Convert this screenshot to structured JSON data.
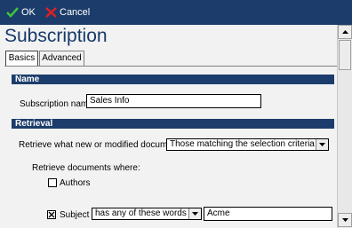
{
  "toolbar": {
    "ok_label": "OK",
    "cancel_label": "Cancel"
  },
  "form": {
    "title": "Subscription"
  },
  "tabs": [
    {
      "label": "Basics",
      "active": true
    },
    {
      "label": "Advanced",
      "active": false
    }
  ],
  "name_section": {
    "heading": "Name",
    "subscription_name_label": "Subscription name:",
    "subscription_name_value": "Sales Info"
  },
  "retrieval_section": {
    "heading": "Retrieval",
    "retrieve_label": "Retrieve what new or modified documents:",
    "retrieve_value": "Those matching the selection criteria",
    "where_label": "Retrieve documents where:",
    "authors": {
      "label": "Authors",
      "checked": false
    },
    "subject": {
      "label": "Subject",
      "checked": true,
      "condition": "has any of these words",
      "value": "Acme"
    }
  },
  "colors": {
    "accent": "#1c3d6b",
    "title": "#173a69",
    "background": "#f2f2f2"
  }
}
